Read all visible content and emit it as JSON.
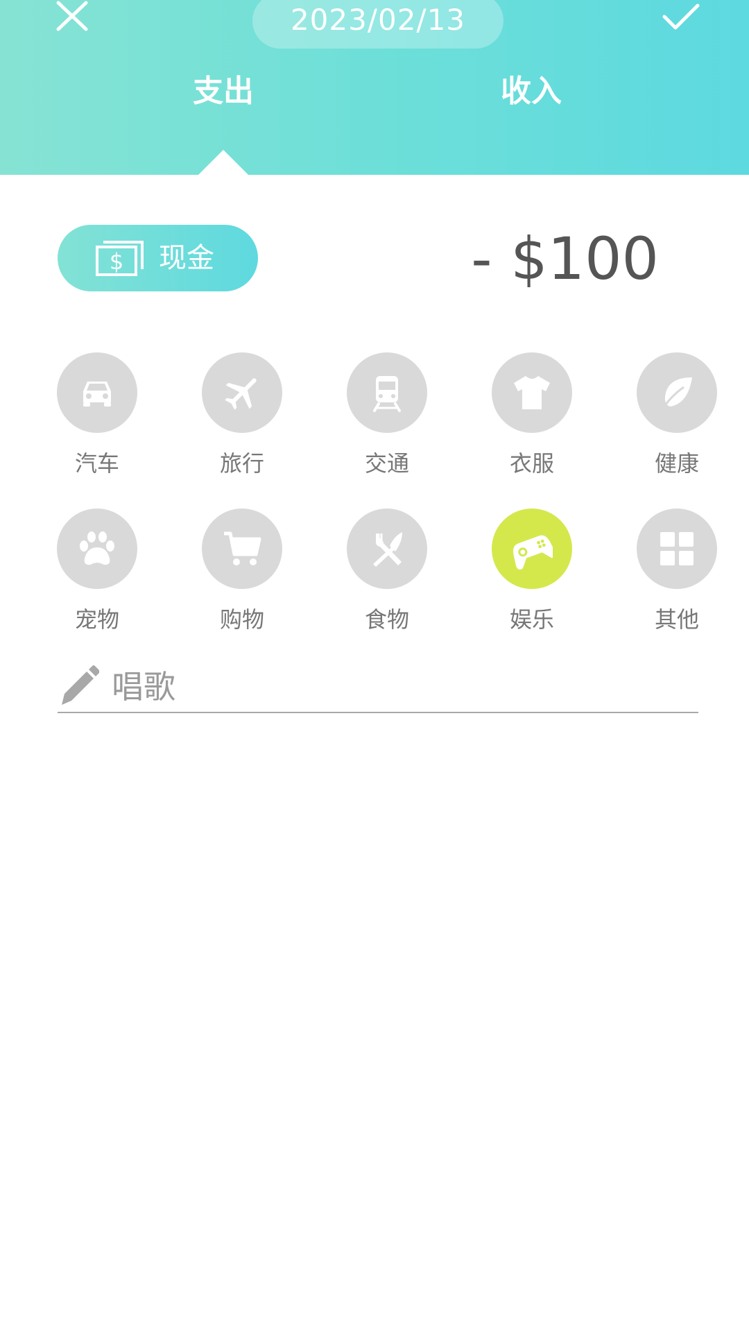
{
  "header": {
    "date": "2023/02/13",
    "tabs": {
      "expense": "支出",
      "income": "收入"
    },
    "selected_tab": "expense",
    "colors": {
      "gradient_start": "#86e3d4",
      "gradient_end": "#5dd9e0"
    }
  },
  "account": {
    "label": "现金",
    "icon": "cash-icon"
  },
  "amount": {
    "text": "- $100"
  },
  "categories": [
    {
      "label": "汽车",
      "icon": "car-icon"
    },
    {
      "label": "旅行",
      "icon": "airplane-icon"
    },
    {
      "label": "交通",
      "icon": "train-icon"
    },
    {
      "label": "衣服",
      "icon": "tshirt-icon"
    },
    {
      "label": "健康",
      "icon": "leaf-icon"
    },
    {
      "label": "宠物",
      "icon": "paw-icon"
    },
    {
      "label": "购物",
      "icon": "cart-icon"
    },
    {
      "label": "食物",
      "icon": "fork-knife-icon"
    },
    {
      "label": "娱乐",
      "icon": "gamepad-icon",
      "selected": true
    },
    {
      "label": "其他",
      "icon": "grid-icon"
    }
  ],
  "selected_category_color": "#d4e84c",
  "note": {
    "value": "唱歌",
    "icon": "pencil-icon"
  }
}
